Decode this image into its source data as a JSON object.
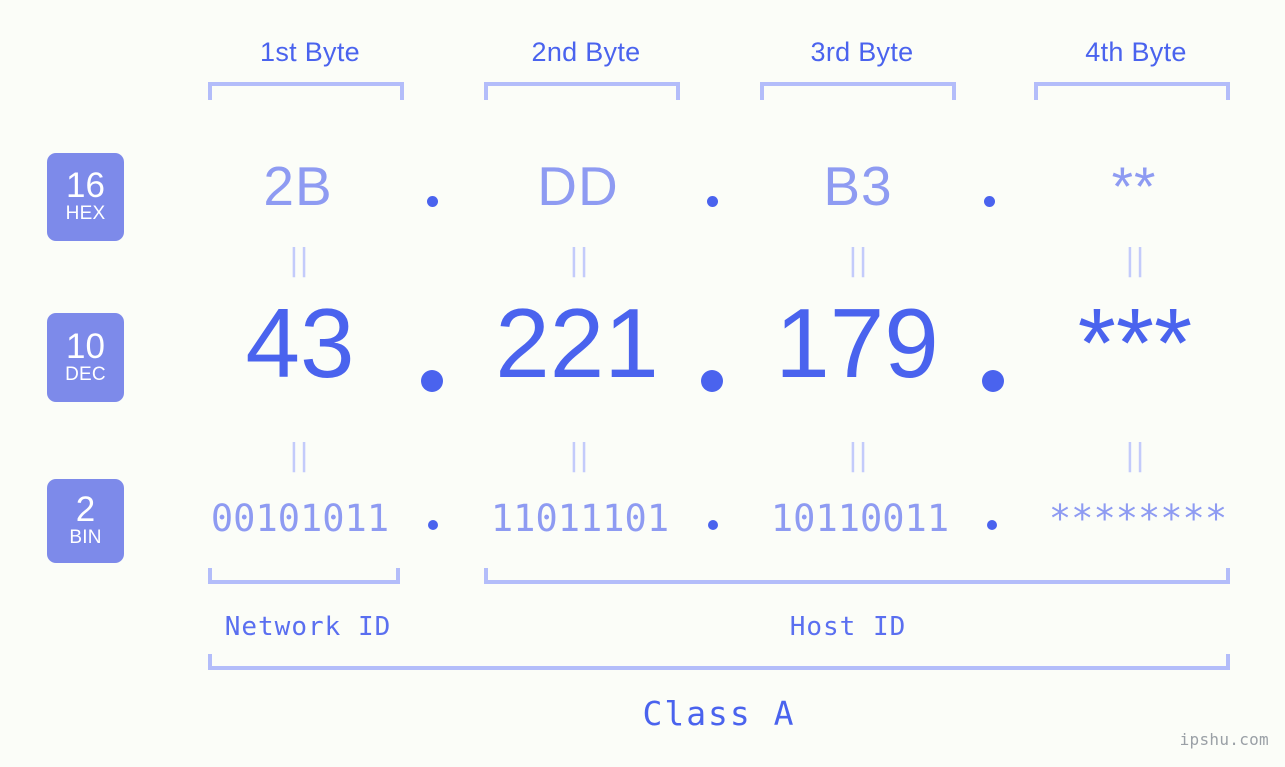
{
  "byte_headers": [
    {
      "label": "1st Byte"
    },
    {
      "label": "2nd Byte"
    },
    {
      "label": "3rd Byte"
    },
    {
      "label": "4th Byte"
    }
  ],
  "rows": {
    "hex": {
      "badge_base": "16",
      "badge_system": "HEX",
      "values": [
        "2B",
        "DD",
        "B3",
        "**"
      ],
      "separator": "."
    },
    "dec": {
      "badge_base": "10",
      "badge_system": "DEC",
      "values": [
        "43",
        "221",
        "179",
        "***"
      ],
      "separator": "."
    },
    "bin": {
      "badge_base": "2",
      "badge_system": "BIN",
      "values": [
        "00101011",
        "11011101",
        "10110011",
        "********"
      ],
      "separator": "."
    }
  },
  "equals_marks": {
    "hex_to_dec": [
      "||",
      "||",
      "||",
      "||"
    ],
    "dec_to_bin": [
      "||",
      "||",
      "||",
      "||"
    ]
  },
  "sections": {
    "network_id": "Network ID",
    "host_id": "Host ID",
    "class": "Class A"
  },
  "watermark": "ipshu.com",
  "colors": {
    "background": "#fbfdf8",
    "accent_strong": "#4a63ee",
    "accent_light": "#8e9bf2",
    "bracket": "#b3bdfa",
    "badge_bg": "#7d8aea",
    "badge_text": "#ffffff",
    "equals": "#c3cbfb",
    "watermark": "#9aa0a6"
  }
}
